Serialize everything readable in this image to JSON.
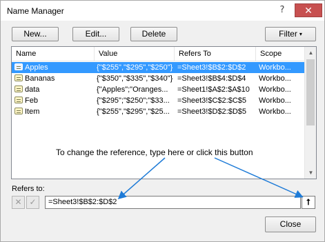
{
  "window": {
    "title": "Name Manager",
    "help_glyph": "?",
    "close_glyph": "✕"
  },
  "toolbar": {
    "new_label": "New...",
    "edit_label": "Edit...",
    "delete_label": "Delete",
    "filter_label": "Filter",
    "filter_caret": "▾"
  },
  "table": {
    "headers": {
      "name": "Name",
      "value": "Value",
      "refers_to": "Refers To",
      "scope": "Scope"
    },
    "rows": [
      {
        "name": "Apples",
        "value": "{\"$255\",\"$295\",\"$250\"}",
        "refers_to": "=Sheet3!$B$2:$D$2",
        "scope": "Workbo...",
        "selected": true
      },
      {
        "name": "Bananas",
        "value": "{\"$350\",\"$335\",\"$340\"}",
        "refers_to": "=Sheet3!$B$4:$D$4",
        "scope": "Workbo...",
        "selected": false
      },
      {
        "name": "data",
        "value": "{\"Apples\";\"Oranges...",
        "refers_to": "=Sheet1!$A$2:$A$10",
        "scope": "Workbo...",
        "selected": false
      },
      {
        "name": "Feb",
        "value": "{\"$295\";\"$250\";\"$33...",
        "refers_to": "=Sheet3!$C$2:$C$5",
        "scope": "Workbo...",
        "selected": false
      },
      {
        "name": "Item",
        "value": "{\"$255\",\"$295\",\"$25...",
        "refers_to": "=Sheet3!$D$2:$D$5",
        "scope": "Workbo...",
        "selected": false
      }
    ]
  },
  "annotation": {
    "text": "To change the reference, type here or click this button"
  },
  "refers": {
    "label": "Refers to:",
    "value": "=Sheet3!$B$2:$D$2",
    "cancel_glyph": "✕",
    "ok_glyph": "✓",
    "collapse_glyph": "⭡"
  },
  "footer": {
    "close_label": "Close"
  },
  "colors": {
    "selection": "#3399ff",
    "arrow": "#1e7bd7"
  }
}
